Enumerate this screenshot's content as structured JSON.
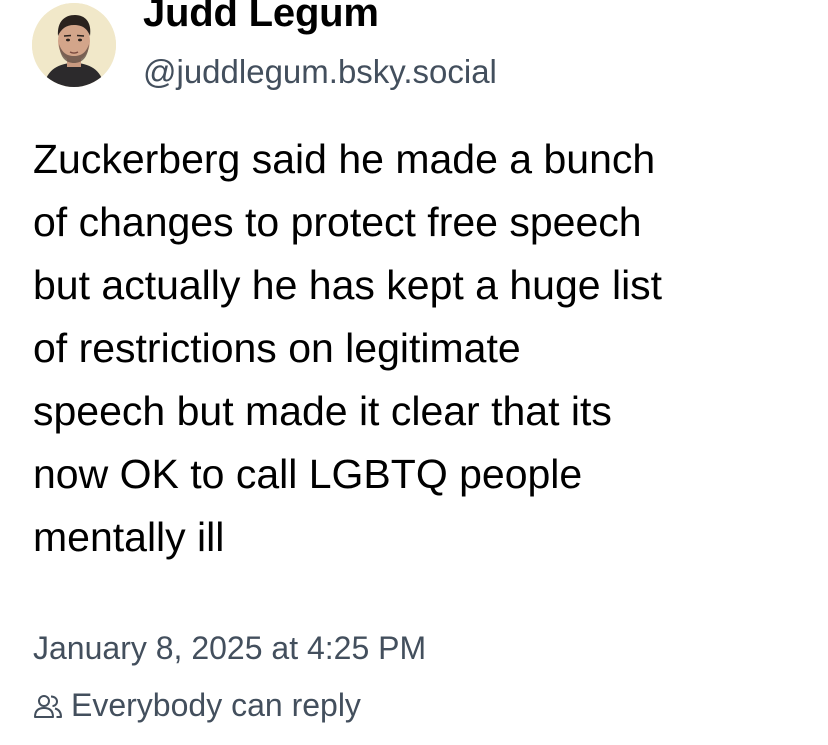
{
  "author": {
    "display_name": "Judd Legum",
    "handle": "@juddlegum.bsky.social",
    "avatar_icon": "profile-photo"
  },
  "post": {
    "lines": [
      "Zuckerberg said he made a bunch",
      "of changes to protect free speech",
      "but actually he has kept a huge list",
      "of restrictions on legitimate",
      "speech but made it clear that its",
      "now OK to call LGBTQ people",
      "mentally ill"
    ]
  },
  "meta": {
    "timestamp": "January 8, 2025 at 4:25 PM",
    "reply_setting": "Everybody can reply",
    "reply_icon": "people-icon"
  },
  "colors": {
    "text": "#000000",
    "muted": "#434f5d",
    "background": "#ffffff"
  }
}
